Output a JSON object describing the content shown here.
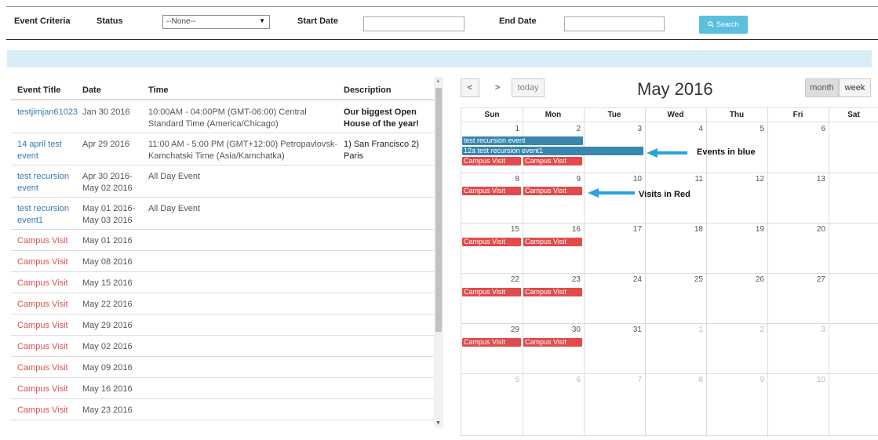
{
  "criteria": {
    "event_criteria_label": "Event Criteria",
    "status_label": "Status",
    "status_value": "--None--",
    "start_date_label": "Start Date",
    "end_date_label": "End Date",
    "search_label": "Search",
    "search_icon": "search-icon",
    "accent": "#5bc0de"
  },
  "table": {
    "headers": [
      "Event Title",
      "Date",
      "Time",
      "Description"
    ],
    "rows": [
      {
        "title": "testjimjan61023",
        "date": "Jan 30 2016",
        "time": "10:00AM - 04:00PM (GMT-06:00) Central Standard Time (America/Chicago)",
        "desc": "Our biggest Open House of the year!"
      },
      {
        "title": "14 april test event",
        "date": "Apr 29 2016",
        "time": "11:00 AM - 5:00 PM (GMT+12:00) Petropavlovsk-Kamchatski Time (Asia/Kamchatka)",
        "desc": "1) San Francisco 2) Paris"
      },
      {
        "title": "test recursion event",
        "date": "Apr 30 2016- May 02 2016",
        "time": "All Day Event",
        "desc": ""
      },
      {
        "title": "test recursion event1",
        "date": "May 01 2016- May 03 2016",
        "time": "All Day Event",
        "desc": ""
      },
      {
        "title": "Campus Visit",
        "date": "May 01 2016",
        "time": "",
        "desc": ""
      },
      {
        "title": "Campus Visit",
        "date": "May 08 2016",
        "time": "",
        "desc": ""
      },
      {
        "title": "Campus Visit",
        "date": "May 15 2016",
        "time": "",
        "desc": ""
      },
      {
        "title": "Campus Visit",
        "date": "May 22 2016",
        "time": "",
        "desc": ""
      },
      {
        "title": "Campus Visit",
        "date": "May 29 2016",
        "time": "",
        "desc": ""
      },
      {
        "title": "Campus Visit",
        "date": "May 02 2016",
        "time": "",
        "desc": ""
      },
      {
        "title": "Campus Visit",
        "date": "May 09 2016",
        "time": "",
        "desc": ""
      },
      {
        "title": "Campus Visit",
        "date": "May 16 2016",
        "time": "",
        "desc": ""
      },
      {
        "title": "Campus Visit",
        "date": "May 23 2016",
        "time": "",
        "desc": ""
      }
    ]
  },
  "calendar": {
    "prev": "<",
    "next": ">",
    "today": "today",
    "title": "May 2016",
    "month_view": "month",
    "week_view": "week",
    "day_names": [
      "Sun",
      "Mon",
      "Tue",
      "Wed",
      "Thu",
      "Fri",
      "Sat"
    ],
    "weeks": [
      [
        "1",
        "2",
        "3",
        "4",
        "5",
        "6",
        ""
      ],
      [
        "8",
        "9",
        "10",
        "11",
        "12",
        "13",
        ""
      ],
      [
        "15",
        "16",
        "17",
        "18",
        "19",
        "20",
        ""
      ],
      [
        "22",
        "23",
        "24",
        "25",
        "26",
        "27",
        ""
      ],
      [
        "29",
        "30",
        "31",
        "1",
        "2",
        "3",
        ""
      ],
      [
        "5",
        "6",
        "7",
        "8",
        "9",
        "10",
        ""
      ]
    ],
    "event_recursion": "test recursion event",
    "event_recursion1": "12a test recursion event1",
    "visit_label": "Campus Visit",
    "annot_blue": "Events in blue",
    "annot_red": "Visits in Red",
    "event_color": "#3a87ad",
    "visit_color": "#e14b4b",
    "arrow_color": "#29a3e0"
  }
}
